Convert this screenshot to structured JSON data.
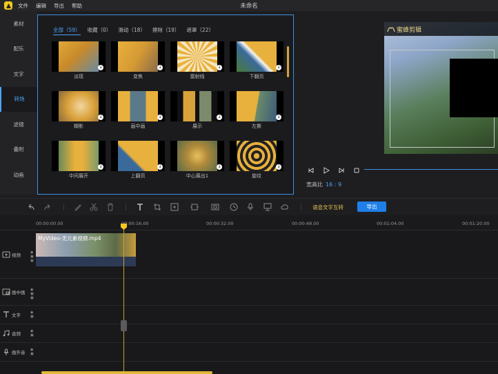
{
  "app": {
    "window_title": "未命名",
    "menu": [
      "文件",
      "编辑",
      "导出",
      "帮助"
    ]
  },
  "sidebar": {
    "items": [
      {
        "label": "素材"
      },
      {
        "label": "配乐"
      },
      {
        "label": "文字"
      },
      {
        "label": "转场"
      },
      {
        "label": "滤镜"
      },
      {
        "label": "叠附"
      },
      {
        "label": "动画"
      }
    ],
    "active_index": 3
  },
  "library": {
    "filters": [
      {
        "label": "全部（59）"
      },
      {
        "label": "收藏（0）"
      },
      {
        "label": "滑动（18）"
      },
      {
        "label": "擦除（19）"
      },
      {
        "label": "遮罩（22）"
      }
    ],
    "active_filter": 0,
    "items": [
      {
        "label": "淡现"
      },
      {
        "label": "变焦"
      },
      {
        "label": "雷射线"
      },
      {
        "label": "下翻页"
      },
      {
        "label": "糊影"
      },
      {
        "label": "画中画"
      },
      {
        "label": "展示"
      },
      {
        "label": "左撕"
      },
      {
        "label": "中间展开"
      },
      {
        "label": "上翻页"
      },
      {
        "label": "中心展出1"
      },
      {
        "label": "旋纹"
      }
    ]
  },
  "preview": {
    "overlay_title": "蜜蜂剪辑",
    "aspect_label": "宽高比",
    "aspect_value": "16 : 9"
  },
  "toolbar": {
    "speech_label": "语音文字互转",
    "export_label": "导出"
  },
  "ruler": {
    "ticks": [
      "00:00:00.00",
      "00:00:16.00",
      "00:00:32.00",
      "00:00:48.00",
      "00:01:04.00",
      "00:01:20.00"
    ]
  },
  "tracks": [
    {
      "name": "视频",
      "icon": "video-track-icon"
    },
    {
      "name": "画中画",
      "icon": "pip-track-icon"
    },
    {
      "name": "文字",
      "icon": "text-track-icon"
    },
    {
      "name": "音频",
      "icon": "music-track-icon"
    },
    {
      "name": "画外音",
      "icon": "mic-track-icon"
    }
  ],
  "clip": {
    "name": "MyVideo-无元素视频.mp4"
  },
  "colors": {
    "accent": "#3f8fe0",
    "brand": "#f2c81e",
    "playhead": "#c8a227"
  }
}
